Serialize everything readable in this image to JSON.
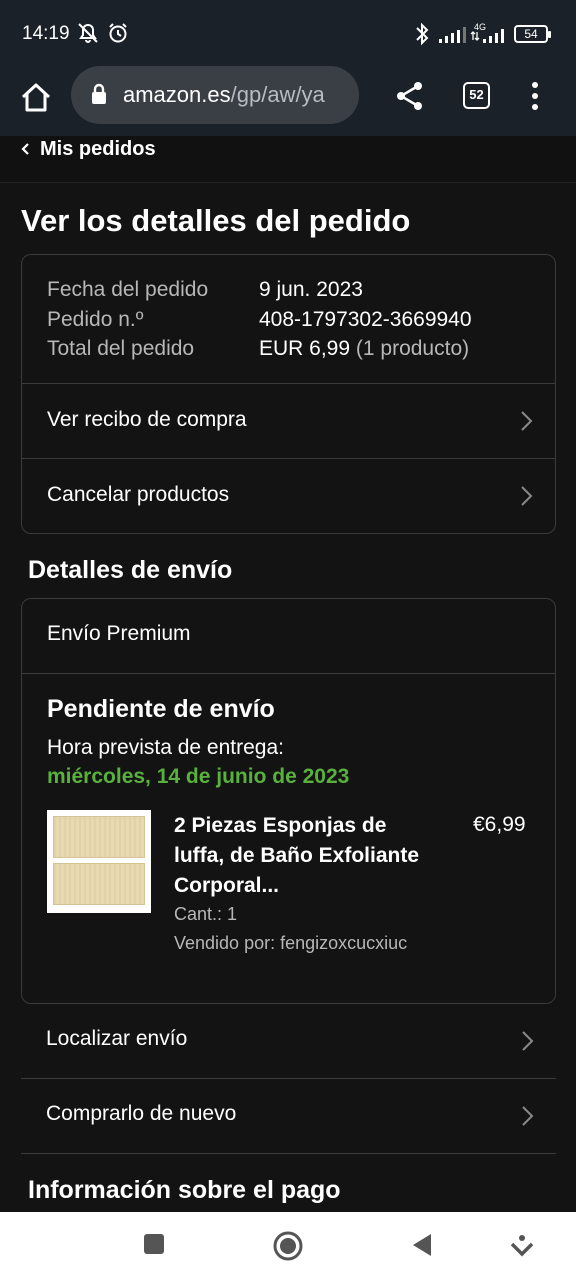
{
  "status_bar": {
    "time": "14:19",
    "network": "4G",
    "battery": "54"
  },
  "browser": {
    "url_domain": "amazon.es",
    "url_path": "/gp/aw/ya",
    "tab_count": "52"
  },
  "nav": {
    "back_label": "Mis pedidos"
  },
  "page": {
    "title": "Ver los detalles del pedido"
  },
  "order_summary": {
    "date_label": "Fecha del pedido",
    "date_value": "9 jun. 2023",
    "order_label": "Pedido n.º",
    "order_value": "408-1797302-3669940",
    "total_label": "Total del pedido",
    "total_value": "EUR 6,99",
    "total_note": "(1 producto)",
    "links": [
      {
        "label": "Ver recibo de compra"
      },
      {
        "label": "Cancelar productos"
      }
    ]
  },
  "shipping": {
    "section_title": "Detalles de envío",
    "method": "Envío Premium",
    "status": "Pendiente de envío",
    "eta_label": "Hora prevista de entrega:",
    "eta_date": "miércoles, 14 de junio de 2023",
    "eta_color": "#58b13d",
    "product": {
      "title": "2 Piezas Esponjas de luffa, de Baño Exfoliante Corporal...",
      "price": "€6,99",
      "qty": "Cant.: 1",
      "seller": "Vendido por: fengizoxcucxiuc"
    },
    "actions": [
      {
        "label": "Localizar envío"
      },
      {
        "label": "Comprarlo de nuevo"
      }
    ]
  },
  "payment": {
    "section_title": "Información sobre el pago"
  }
}
